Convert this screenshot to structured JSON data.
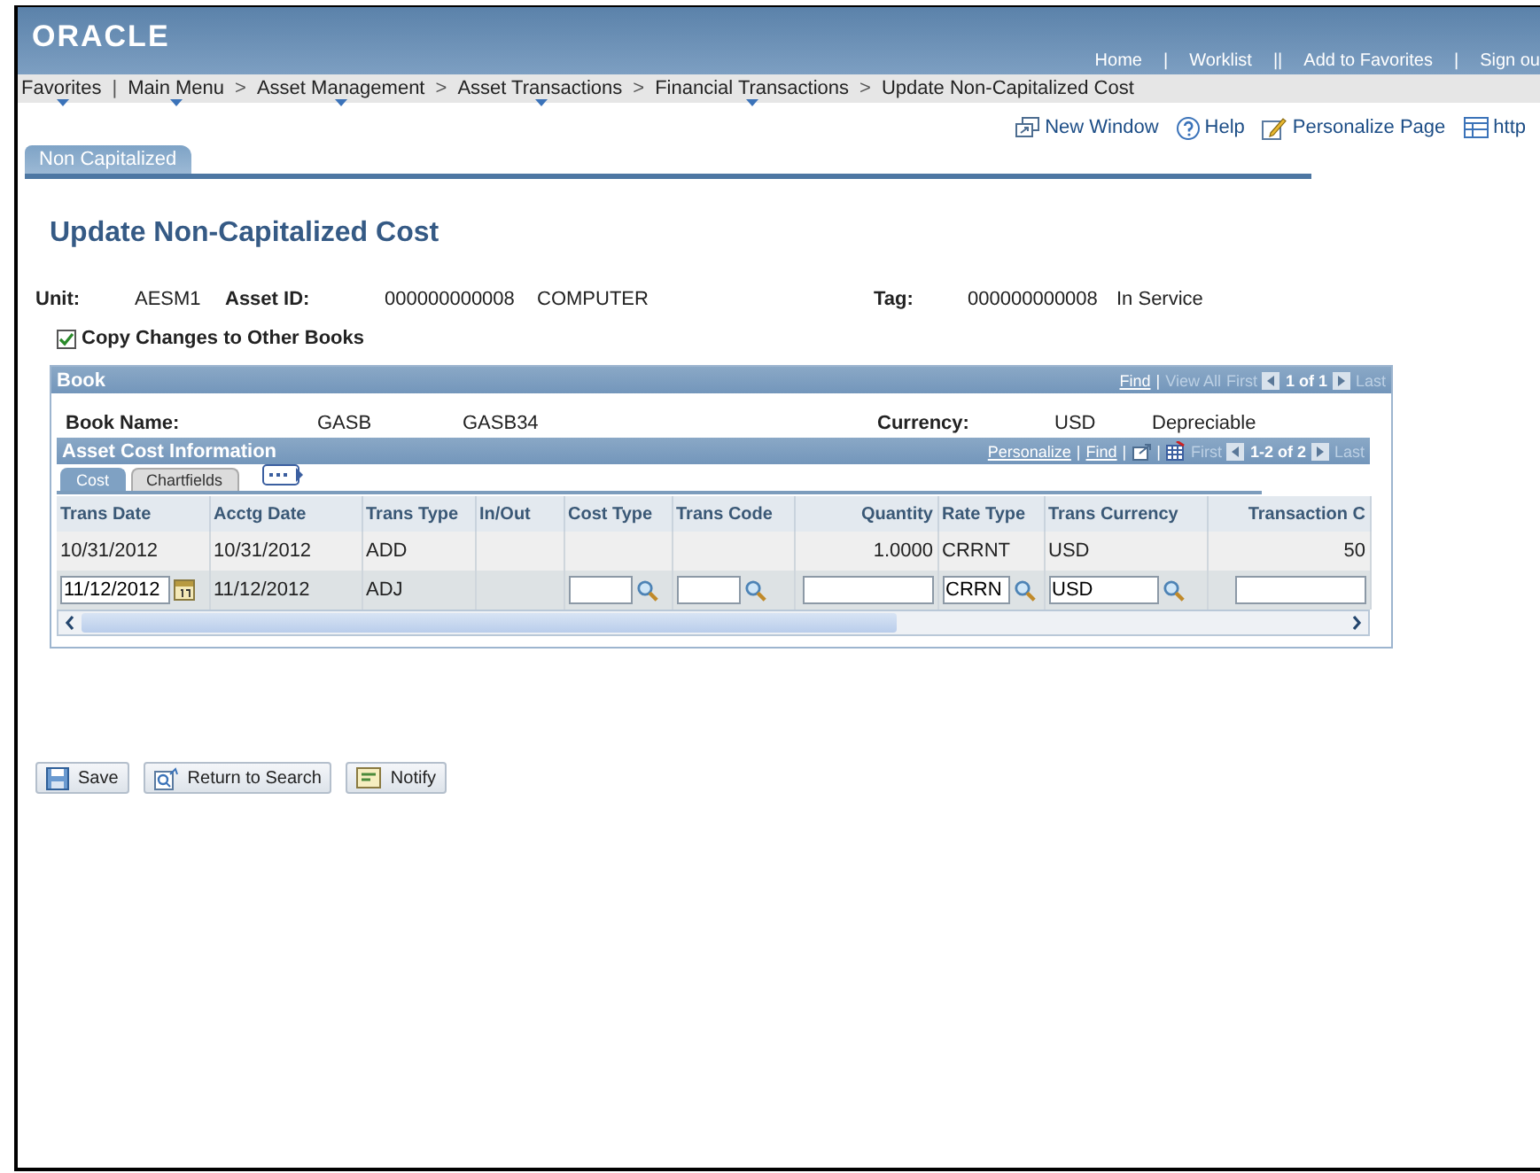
{
  "header": {
    "logo": "ORACLE",
    "links": [
      {
        "label": "Home",
        "sep": "|"
      },
      {
        "label": "Worklist",
        "sep": "||"
      },
      {
        "label": "Add to Favorites",
        "sep": "|"
      },
      {
        "label": "Sign ou"
      }
    ]
  },
  "breadcrumb": [
    {
      "label": "Favorites",
      "menu": true,
      "sep": "|"
    },
    {
      "label": "Main Menu",
      "menu": true,
      "sep": ">"
    },
    {
      "label": "Asset Management",
      "menu": true,
      "sep": ">"
    },
    {
      "label": "Asset Transactions",
      "menu": true,
      "sep": ">"
    },
    {
      "label": "Financial Transactions",
      "menu": true,
      "sep": ">"
    },
    {
      "label": "Update Non-Capitalized Cost",
      "menu": false
    }
  ],
  "toolbar_links": [
    {
      "label": "New Window",
      "kind": "window"
    },
    {
      "label": "Help",
      "kind": "help"
    },
    {
      "label": "Personalize Page",
      "kind": "personalize"
    },
    {
      "label": "http",
      "kind": "http"
    }
  ],
  "page_tabs": [
    {
      "label": "Non Capitalized",
      "selected": true
    }
  ],
  "title": "Update Non-Capitalized Cost",
  "fields": [
    {
      "label": "Unit:",
      "value": "AESM1"
    },
    {
      "label": "Asset ID:",
      "value": "000000000008",
      "extra": "COMPUTER"
    },
    {
      "label": "Tag:",
      "value": "000000000008",
      "extra": "In Service"
    }
  ],
  "copy_changes": {
    "label": "Copy Changes to Other Books",
    "checked": true
  },
  "book": {
    "title": "Book",
    "nav": [
      {
        "kind": "link",
        "label": "Find"
      },
      {
        "kind": "sep",
        "label": "|"
      },
      {
        "kind": "disabled",
        "label": "View All"
      },
      {
        "kind": "disabled",
        "label": "First"
      },
      {
        "kind": "prev"
      },
      {
        "kind": "count",
        "label": "1 of 1"
      },
      {
        "kind": "next"
      },
      {
        "kind": "disabled",
        "label": "Last"
      }
    ],
    "book_name_label": "Book Name:",
    "book_name": "GASB",
    "book_desc": "GASB34",
    "currency_label": "Currency:",
    "currency": "USD",
    "status": "Depreciable"
  },
  "cost_grid": {
    "title": "Asset Cost Information",
    "nav": [
      {
        "kind": "link",
        "label": "Personalize"
      },
      {
        "kind": "sep",
        "label": "|"
      },
      {
        "kind": "link",
        "label": "Find"
      },
      {
        "kind": "sep",
        "label": "|"
      },
      {
        "kind": "zoom"
      },
      {
        "kind": "sep",
        "label": "|"
      },
      {
        "kind": "download"
      },
      {
        "kind": "disabled",
        "label": "First"
      },
      {
        "kind": "prev"
      },
      {
        "kind": "count",
        "label": "1-2 of 2"
      },
      {
        "kind": "next"
      },
      {
        "kind": "disabled",
        "label": "Last"
      }
    ],
    "tabs": [
      {
        "label": "Cost",
        "selected": true
      },
      {
        "label": "Chartfields",
        "selected": false
      }
    ],
    "columns": [
      {
        "label": "Trans Date",
        "numeric": false
      },
      {
        "label": "Acctg Date",
        "numeric": false
      },
      {
        "label": "Trans Type",
        "numeric": false
      },
      {
        "label": "In/Out",
        "numeric": false
      },
      {
        "label": "Cost Type",
        "numeric": false
      },
      {
        "label": "Trans Code",
        "numeric": false
      },
      {
        "label": "Quantity",
        "numeric": true
      },
      {
        "label": "Rate Type",
        "numeric": false
      },
      {
        "label": "Trans Currency",
        "numeric": false
      },
      {
        "label": "Transaction C",
        "numeric": true
      }
    ],
    "rows": [
      {
        "cells": [
          {
            "kind": "text",
            "value": "10/31/2012"
          },
          {
            "kind": "text",
            "value": "10/31/2012"
          },
          {
            "kind": "text",
            "value": "ADD"
          },
          {
            "kind": "blank"
          },
          {
            "kind": "blank"
          },
          {
            "kind": "blank"
          },
          {
            "kind": "text",
            "value": "1.0000"
          },
          {
            "kind": "text",
            "value": "CRRNT"
          },
          {
            "kind": "text",
            "value": "USD"
          },
          {
            "kind": "text",
            "value": "50"
          }
        ]
      },
      {
        "cells": [
          {
            "kind": "date",
            "value": "11/12/2012"
          },
          {
            "kind": "text",
            "value": "11/12/2012"
          },
          {
            "kind": "text",
            "value": "ADJ"
          },
          {
            "kind": "blank"
          },
          {
            "kind": "lookup"
          },
          {
            "kind": "lookup"
          },
          {
            "kind": "input"
          },
          {
            "kind": "lookup",
            "value": "CRRN"
          },
          {
            "kind": "lookup",
            "value": "USD"
          },
          {
            "kind": "input"
          }
        ]
      }
    ]
  },
  "buttons": [
    {
      "label": "Save",
      "kind": "save"
    },
    {
      "label": "Return to Search",
      "kind": "search"
    },
    {
      "label": "Notify",
      "kind": "notify"
    }
  ]
}
